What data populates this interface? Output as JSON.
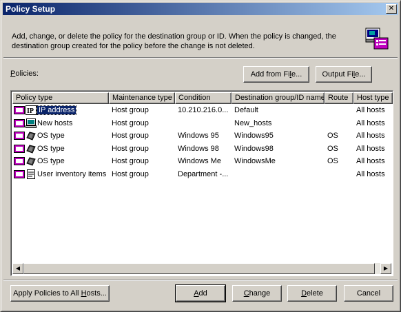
{
  "window": {
    "title": "Policy Setup",
    "close_label": "✕"
  },
  "description": "Add, change, or delete the policy for the destination group or ID. When the policy is changed, the destination group created for the policy before the change is not deleted.",
  "policies_label": {
    "prefix": "P",
    "rest": "olicies:"
  },
  "buttons": {
    "add_from_file": {
      "before": "Add from Fi",
      "key": "l",
      "after": "e..."
    },
    "output_file": {
      "before": "Output Fi",
      "key": "l",
      "after": "e..."
    },
    "apply_all": {
      "before": "Apply Policies to All ",
      "key": "H",
      "after": "osts..."
    },
    "add": {
      "before": "",
      "key": "A",
      "after": "dd"
    },
    "change": {
      "before": "",
      "key": "C",
      "after": "hange"
    },
    "delete": {
      "before": "",
      "key": "D",
      "after": "elete"
    },
    "cancel": {
      "before": "Cancel",
      "key": "",
      "after": ""
    }
  },
  "columns": [
    "Policy type",
    "Maintenance type",
    "Condition",
    "Destination group/ID name",
    "Route",
    "Host type"
  ],
  "rows": [
    {
      "icon": "ip-icon",
      "policy_type": "IP address",
      "maintenance_type": "Host group",
      "condition": "10.210.216.0...",
      "destination": "Default",
      "route": "",
      "host_type": "All hosts",
      "selected": true
    },
    {
      "icon": "computer-icon",
      "policy_type": "New hosts",
      "maintenance_type": "Host group",
      "condition": "",
      "destination": "New_hosts",
      "route": "",
      "host_type": "All hosts",
      "selected": false
    },
    {
      "icon": "os-icon",
      "policy_type": "OS type",
      "maintenance_type": "Host group",
      "condition": "Windows 95",
      "destination": "Windows95",
      "route": "OS",
      "host_type": "All hosts",
      "selected": false
    },
    {
      "icon": "os-icon",
      "policy_type": "OS type",
      "maintenance_type": "Host group",
      "condition": "Windows 98",
      "destination": "Windows98",
      "route": "OS",
      "host_type": "All hosts",
      "selected": false
    },
    {
      "icon": "os-icon",
      "policy_type": "OS type",
      "maintenance_type": "Host group",
      "condition": "Windows Me",
      "destination": "WindowsMe",
      "route": "OS",
      "host_type": "All hosts",
      "selected": false
    },
    {
      "icon": "inventory-icon",
      "policy_type": "User inventory items",
      "maintenance_type": "Host group",
      "condition": "Department -...",
      "destination": "",
      "route": "",
      "host_type": "All hosts",
      "selected": false
    }
  ]
}
